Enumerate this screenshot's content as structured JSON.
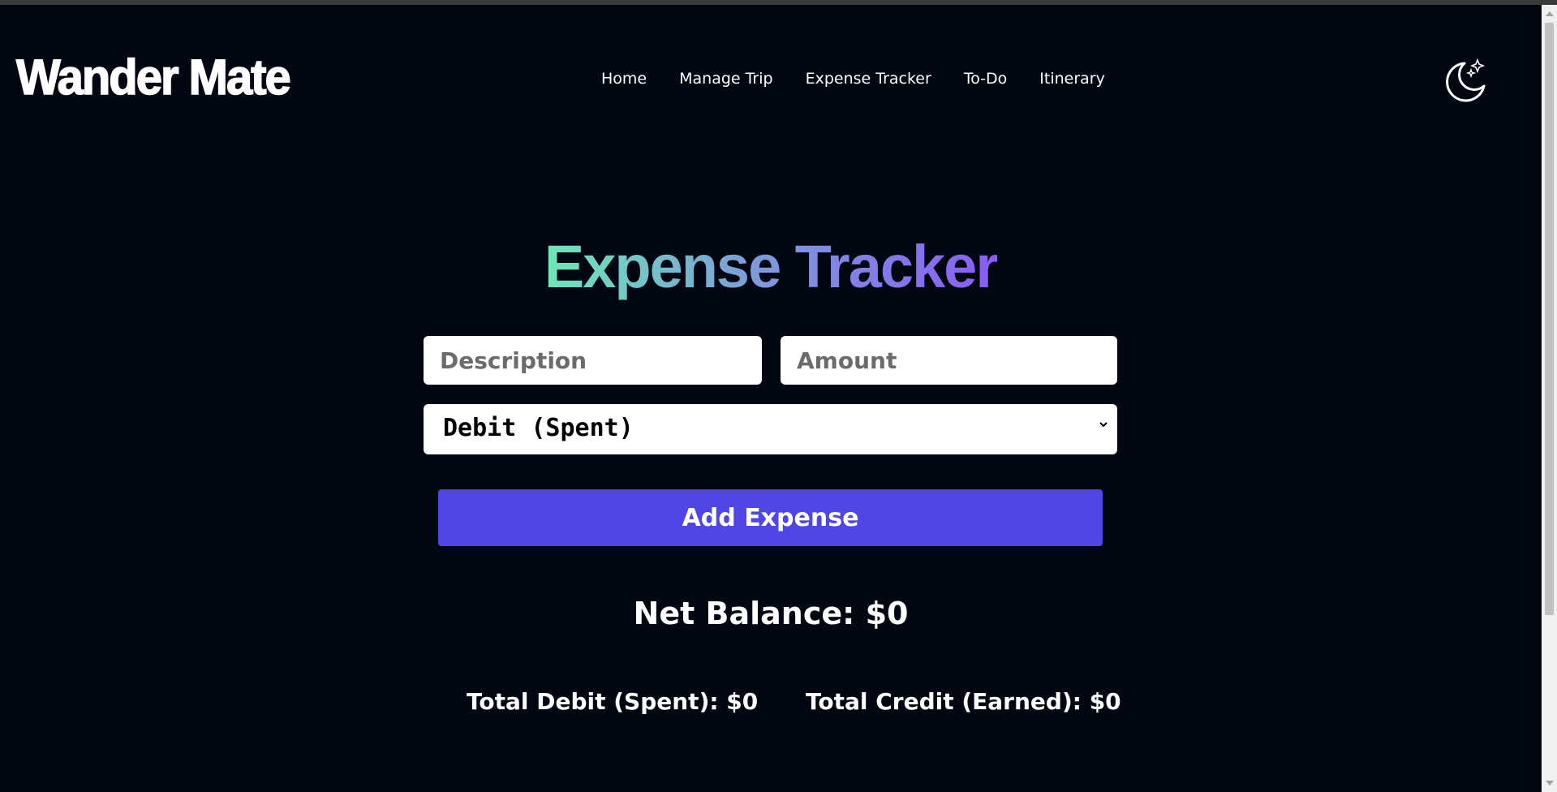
{
  "header": {
    "logo": "Wander Mate",
    "nav": [
      {
        "label": "Home"
      },
      {
        "label": "Manage Trip"
      },
      {
        "label": "Expense Tracker"
      },
      {
        "label": "To-Do"
      },
      {
        "label": "Itinerary"
      }
    ],
    "theme_toggle_icon": "moon-stars-icon"
  },
  "main": {
    "title": "Expense Tracker",
    "description_placeholder": "Description",
    "amount_placeholder": "Amount",
    "type_selected": "Debit (Spent)",
    "add_button": "Add Expense",
    "net_balance": "Net Balance: $0",
    "total_debit": "Total Debit (Spent): $0",
    "total_credit": "Total Credit (Earned): $0"
  },
  "colors": {
    "background": "#030712",
    "button": "#4f46e5",
    "title_gradient_start": "#6ee7b7",
    "title_gradient_end": "#8b5cf6"
  }
}
